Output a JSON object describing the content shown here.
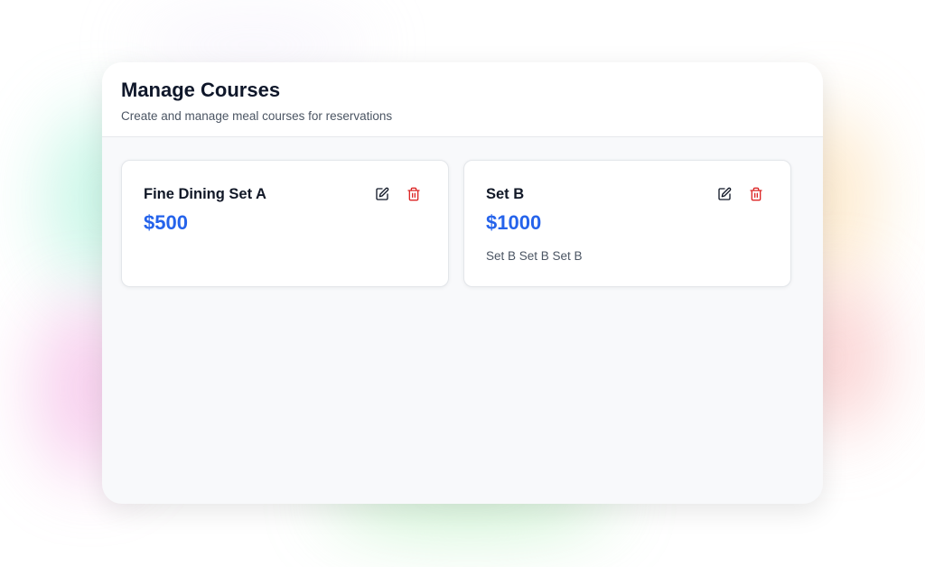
{
  "header": {
    "title": "Manage Courses",
    "subtitle": "Create and manage meal courses for reservations"
  },
  "courses": [
    {
      "name": "Fine Dining Set A",
      "price": "$500",
      "description": "",
      "actions": {
        "edit_icon": "edit-icon",
        "delete_icon": "trash-icon"
      }
    },
    {
      "name": "Set B",
      "price": "$1000",
      "description": "Set B Set B Set B",
      "actions": {
        "edit_icon": "edit-icon",
        "delete_icon": "trash-icon"
      }
    }
  ],
  "colors": {
    "price": "#2563eb",
    "delete": "#dc2626",
    "edit": "#111827",
    "panel_bg": "#f8f9fb"
  }
}
